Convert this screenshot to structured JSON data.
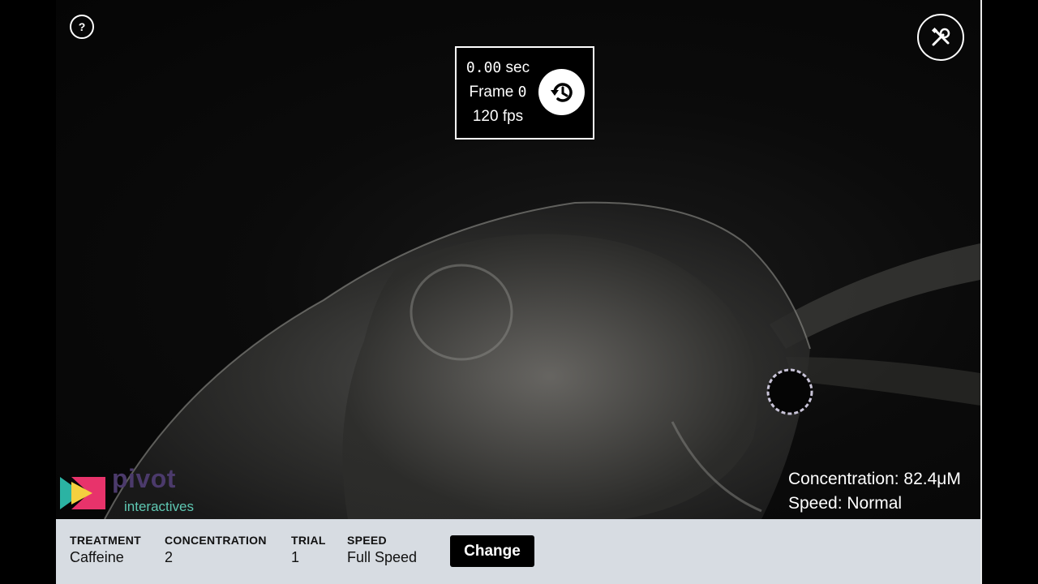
{
  "help": {
    "label": "?"
  },
  "timer": {
    "time_value": "0.00",
    "time_unit": "sec",
    "frame_label": "Frame",
    "frame_value": "0",
    "fps_value": "120",
    "fps_unit": "fps"
  },
  "overlay": {
    "concentration": "Concentration: 82.4μM",
    "speed": "Speed: Normal"
  },
  "logo": {
    "word1": "pivot",
    "word2": "interactives"
  },
  "settings": {
    "fields": [
      {
        "label": "TREATMENT",
        "value": "Caffeine"
      },
      {
        "label": "CONCENTRATION",
        "value": "2"
      },
      {
        "label": "TRIAL",
        "value": "1"
      },
      {
        "label": "SPEED",
        "value": "Full Speed"
      }
    ],
    "change_label": "Change"
  },
  "icons": {
    "help": "question-icon",
    "tools": "tools-icon",
    "reset": "history-icon"
  }
}
